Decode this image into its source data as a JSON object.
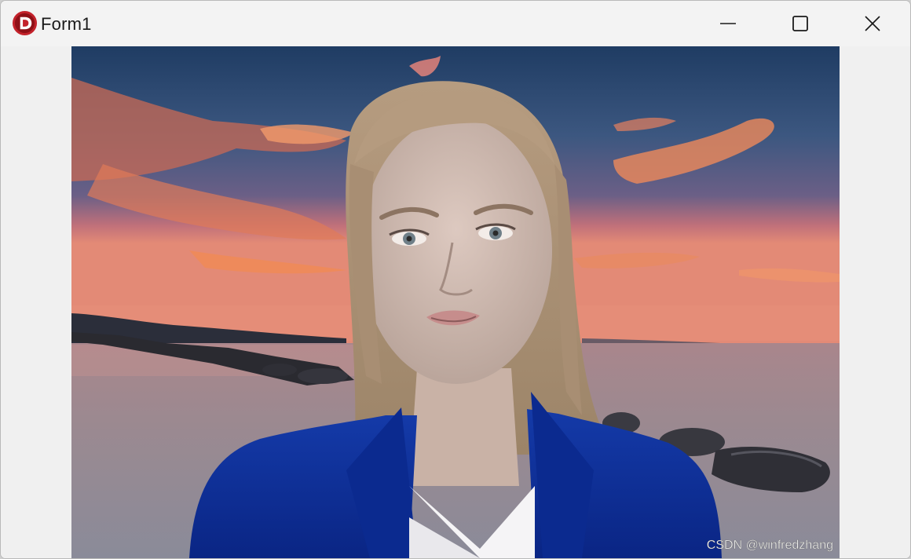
{
  "window": {
    "title": "Form1",
    "controls": {
      "minimize_icon": "minimize-icon",
      "maximize_icon": "maximize-icon",
      "close_icon": "close-icon"
    }
  },
  "app_icon": {
    "name": "delphi-icon",
    "letter": "D",
    "color": "#c3222b"
  },
  "content": {
    "video_subject": "presenter",
    "watermark": "CSDN @winfredzhang"
  },
  "colors": {
    "titlebar": "#f3f3f3",
    "client": "#f0f0f0",
    "jacket": "#0d2e9c"
  }
}
